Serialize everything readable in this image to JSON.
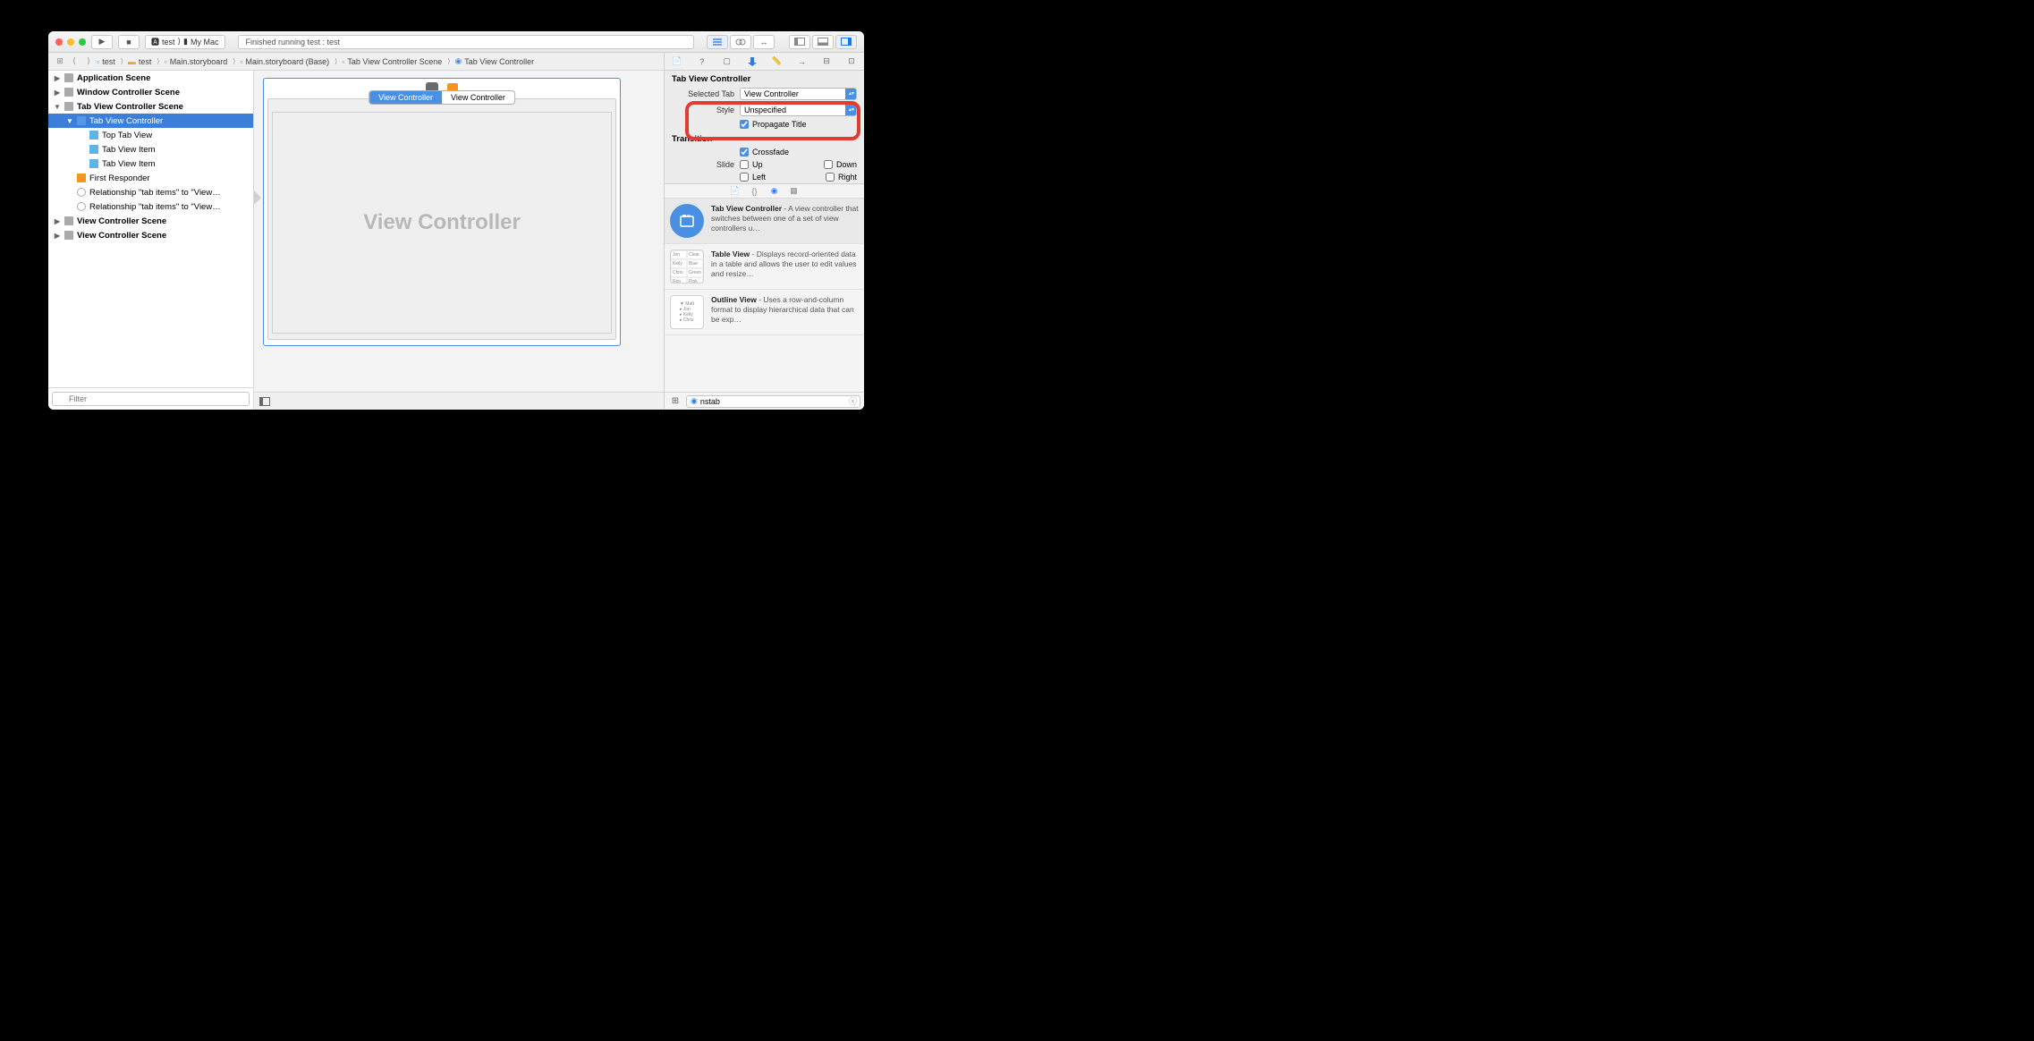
{
  "toolbar": {
    "scheme": "test",
    "destination": "My Mac",
    "status": "Finished running test : test"
  },
  "breadcrumb": [
    "test",
    "test",
    "Main.storyboard",
    "Main.storyboard (Base)",
    "Tab View Controller Scene",
    "Tab View Controller"
  ],
  "outline": {
    "filter_placeholder": "Filter",
    "nodes": [
      {
        "label": "Application Scene",
        "depth": 0,
        "bold": true,
        "icon": "scene"
      },
      {
        "label": "Window Controller Scene",
        "depth": 0,
        "bold": true,
        "icon": "scene"
      },
      {
        "label": "Tab View Controller Scene",
        "depth": 0,
        "bold": true,
        "expanded": true,
        "icon": "scene"
      },
      {
        "label": "Tab View Controller",
        "depth": 1,
        "selected": true,
        "expanded": true,
        "icon": "vc"
      },
      {
        "label": "Top Tab View",
        "depth": 2,
        "icon": "tab"
      },
      {
        "label": "Tab View Item",
        "depth": 2,
        "icon": "tab"
      },
      {
        "label": "Tab View Item",
        "depth": 2,
        "icon": "tab"
      },
      {
        "label": "First Responder",
        "depth": 1,
        "icon": "cube"
      },
      {
        "label": "Relationship \"tab items\" to \"View…",
        "depth": 1,
        "icon": "seg"
      },
      {
        "label": "Relationship \"tab items\" to \"View…",
        "depth": 1,
        "icon": "seg"
      },
      {
        "label": "View Controller Scene",
        "depth": 0,
        "bold": true,
        "icon": "scene"
      },
      {
        "label": "View Controller Scene",
        "depth": 0,
        "bold": true,
        "icon": "scene"
      }
    ]
  },
  "canvas": {
    "tabs": [
      "View Controller",
      "View Controller"
    ],
    "active_tab": 0,
    "content_label": "View Controller"
  },
  "inspector": {
    "section_title": "Tab View Controller",
    "selected_tab_label": "Selected Tab",
    "selected_tab_value": "View Controller",
    "style_label": "Style",
    "style_value": "Unspecified",
    "propagate_title_label": "Propagate Title",
    "propagate_title_checked": true,
    "transition_title": "Transition",
    "crossfade_label": "Crossfade",
    "crossfade_checked": true,
    "slide_label": "Slide",
    "slide_up": "Up",
    "slide_down": "Down",
    "slide_left": "Left",
    "slide_right": "Right"
  },
  "library": {
    "items": [
      {
        "title": "Tab View Controller",
        "desc": " - A view controller that switches between one of a set of view controllers u…",
        "thumb": "tabvc",
        "selected": true
      },
      {
        "title": "Table View",
        "desc": " - Displays record-oriented data in a table and allows the user to edit values and resize…",
        "thumb": "table"
      },
      {
        "title": "Outline View",
        "desc": " - Uses a row-and-column format to display hierarchical data that can be exp…",
        "thumb": "outline"
      }
    ],
    "search_value": "nstab"
  },
  "table_mini": {
    "rows": [
      [
        "Jon",
        "Clear"
      ],
      [
        "Kelly",
        "Blue"
      ],
      [
        "Chris",
        "Green"
      ],
      [
        "Ron",
        "Pink"
      ]
    ]
  },
  "outline_mini": [
    "▼ Matt",
    "  ▸ Jon",
    "  ▸ Kelly",
    "  ▸ Chris"
  ]
}
